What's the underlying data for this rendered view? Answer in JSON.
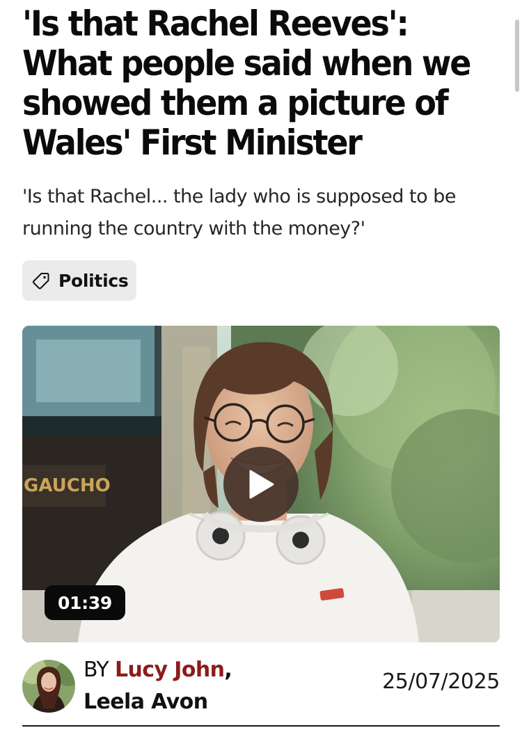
{
  "article": {
    "headline": "'Is that Rachel Reeves': What people said when we showed them a picture of Wales' First Minister",
    "standfirst": "'Is that Rachel... the lady who is supposed to be running the country with the money?'",
    "tag": {
      "icon": "tag-icon",
      "label": "Politics"
    },
    "video": {
      "duration": "01:39",
      "play_icon": "play-icon",
      "storefront_sign": "GAUCHO"
    },
    "byline": {
      "prefix": "BY",
      "authors": [
        "Lucy John",
        "Leela Avon"
      ],
      "separator": ",",
      "date": "25/07/2025",
      "author_color": "#8c1c1c"
    }
  }
}
